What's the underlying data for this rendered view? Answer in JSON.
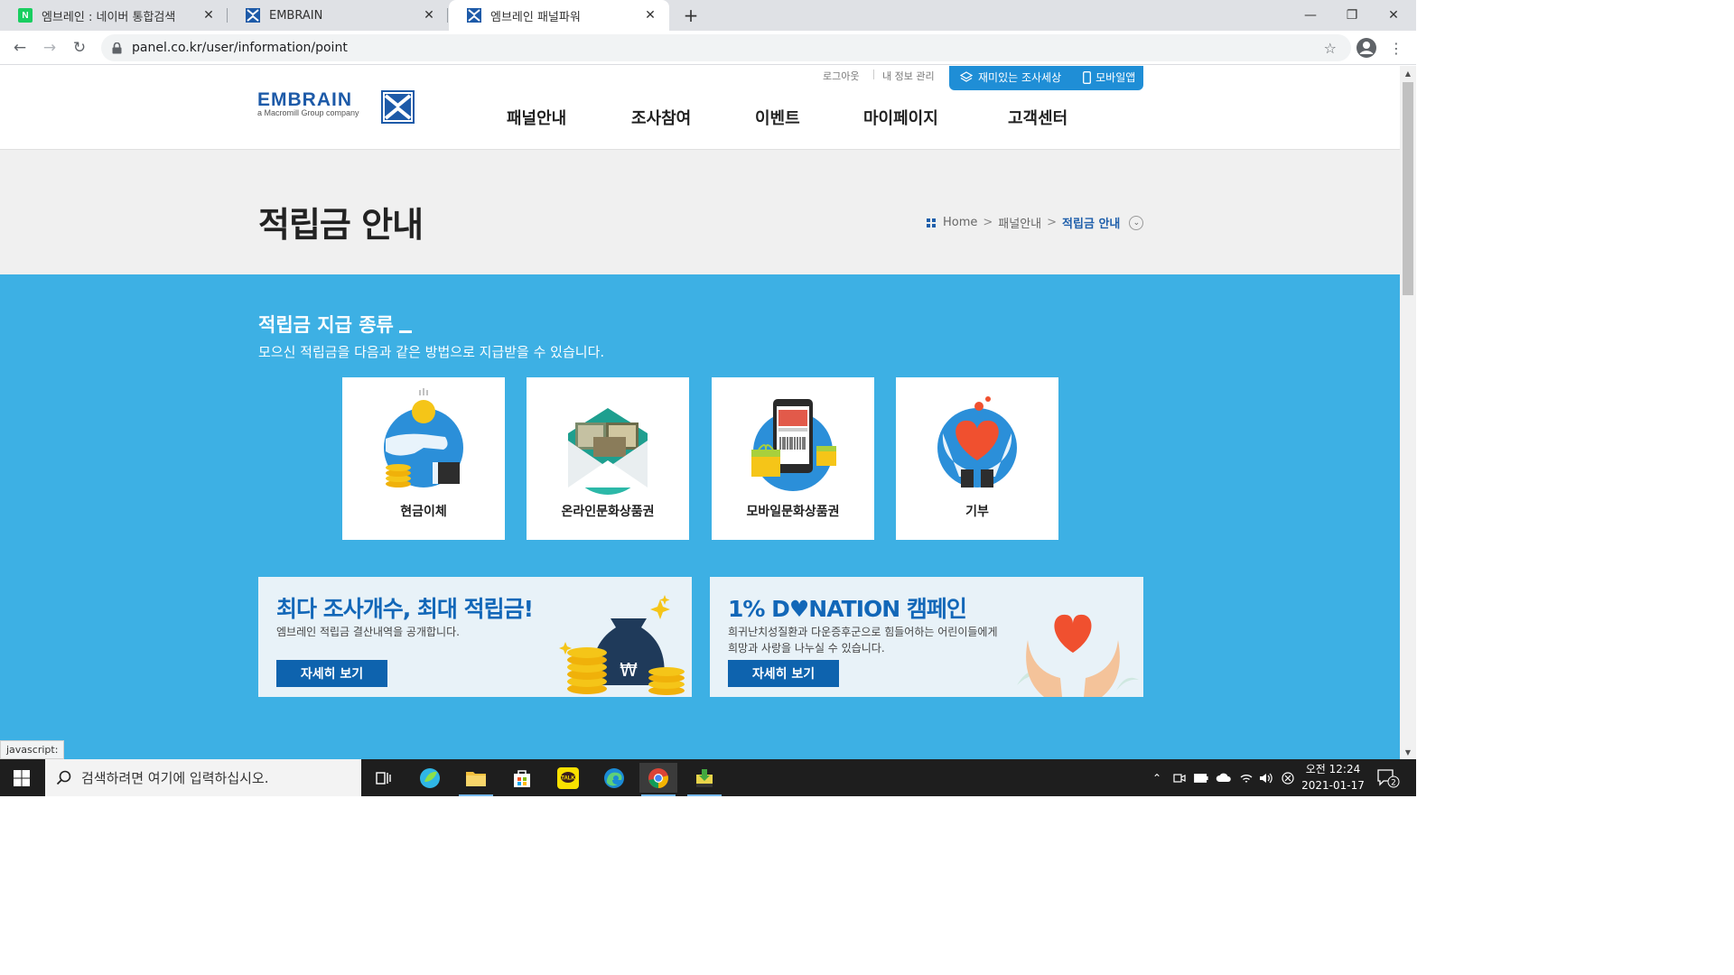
{
  "browser": {
    "tabs": [
      {
        "title": "엠브레인 : 네이버 통합검색",
        "favicon": "naver-icon"
      },
      {
        "title": "EMBRAIN",
        "favicon": "embrain-icon"
      },
      {
        "title": "엠브레인 패널파워",
        "favicon": "embrain-icon",
        "active": true
      }
    ],
    "url": "panel.co.kr/user/information/point",
    "status_text": "javascript:"
  },
  "header": {
    "logo_text": "EMBRAIN",
    "logo_sub": "a Macromill Group company",
    "util_links": [
      "로그아웃",
      "내 정보 관리"
    ],
    "fun_survey": "재미있는 조사세상",
    "mobile_app": "모바일앱",
    "nav": [
      "패널안내",
      "조사참여",
      "이벤트",
      "마이페이지",
      "고객센터"
    ]
  },
  "title_band": {
    "title": "적립금 안내",
    "breadcrumb": [
      "Home",
      "패널안내",
      "적립금 안내"
    ]
  },
  "section": {
    "title": "적립금 지급 종류",
    "subtitle": "모으신 적립금을 다음과 같은 방법으로 지급받을 수 있습니다.",
    "cards": [
      {
        "label": "현금이체",
        "icon": "cash-transfer-icon"
      },
      {
        "label": "온라인문화상품권",
        "icon": "online-gift-card-icon"
      },
      {
        "label": "모바일문화상품권",
        "icon": "mobile-gift-card-icon"
      },
      {
        "label": "기부",
        "icon": "donation-heart-icon"
      }
    ],
    "banners": [
      {
        "title": "최다 조사개수, 최대 적립금!",
        "lines": [
          "엠브레인 적립금 결산내역을 공개합니다."
        ],
        "button": "자세히 보기"
      },
      {
        "title": "1% D♥NATION 캠페인",
        "lines": [
          "희귀난치성질환과 다운증후군으로 힘들어하는 어린이들에게",
          "희망과 사랑을 나누실 수 있습니다."
        ],
        "button": "자세히 보기"
      }
    ]
  },
  "taskbar": {
    "search_placeholder": "검색하려면 여기에 입력하십시오.",
    "time": "오전 12:24",
    "date": "2021-01-17",
    "notification_count": "2"
  },
  "colors": {
    "brand_blue": "#1d5aa8",
    "section_blue": "#3db0e4",
    "button_blue": "#0e63ae",
    "heart_red": "#f0502f"
  }
}
